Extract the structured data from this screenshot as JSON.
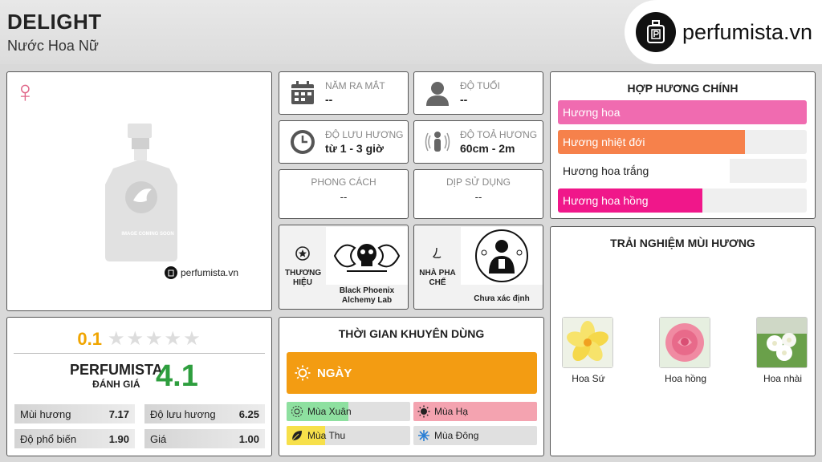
{
  "header": {
    "title": "DELIGHT",
    "subtitle": "Nước Hoa Nữ",
    "logo_text": "perfumista.vn"
  },
  "product": {
    "gender_symbol": "♀",
    "placeholder_text": "IMAGE COMING SOON",
    "watermark": "perfumista.vn"
  },
  "rating": {
    "user_score": "0.1",
    "stars_total": 5,
    "stars_filled": 0,
    "perfumista_label": "PERFUMISTA",
    "perfumista_sub": "ĐÁNH GIÁ",
    "perfumista_score": "4.1",
    "metrics": [
      {
        "label": "Mùi hương",
        "value": "7.17"
      },
      {
        "label": "Độ lưu hương",
        "value": "6.25"
      },
      {
        "label": "Độ phổ biến",
        "value": "1.90"
      },
      {
        "label": "Giá",
        "value": "1.00"
      }
    ]
  },
  "info": {
    "release": {
      "label": "NĂM RA MẮT",
      "value": "--"
    },
    "age": {
      "label": "ĐỘ TUỔI",
      "value": "--"
    },
    "longevity": {
      "label": "ĐỘ LƯU HƯƠNG",
      "value": "từ 1 - 3 giờ"
    },
    "sillage": {
      "label": "ĐỘ TOẢ HƯƠNG",
      "value": "60cm - 2m"
    },
    "style": {
      "label": "PHONG CÁCH",
      "value": "--"
    },
    "occasion": {
      "label": "DỊP SỬ DỤNG",
      "value": "--"
    },
    "brand": {
      "label": "THƯƠNG HIỆU",
      "value": "Black Phoenix Alchemy Lab"
    },
    "perfumer": {
      "label": "NHÀ PHA CHẾ",
      "value": "Chưa xác định"
    }
  },
  "time": {
    "heading": "THỜI GIAN KHUYÊN DÙNG",
    "day_label": "NGÀY",
    "seasons": [
      {
        "label": "Mùa Xuân",
        "level": 0.5,
        "color": "#8ee0a0",
        "icon": "spring-icon"
      },
      {
        "label": "Mùa Hạ",
        "level": 1.0,
        "color": "#f4a3b0",
        "icon": "summer-icon"
      },
      {
        "label": "Mùa Thu",
        "level": 0.31,
        "color": "#f7e04a",
        "icon": "leaf-icon"
      },
      {
        "label": "Mùa Đông",
        "level": 0.0,
        "color": "#b6d4ef",
        "icon": "snowflake-icon"
      }
    ]
  },
  "accords": {
    "heading": "HỢP HƯƠNG CHÍNH",
    "items": [
      {
        "label": "Hương hoa",
        "level": 1.0,
        "color": "#f06bb0"
      },
      {
        "label": "Hương nhiệt đới",
        "level": 0.75,
        "color": "#f6814b"
      },
      {
        "label": "Hương hoa trắng",
        "level": 0.69,
        "color": "#ffffff"
      },
      {
        "label": "Hương hoa hồng",
        "level": 0.58,
        "color": "#f0178a"
      }
    ]
  },
  "notes": {
    "heading": "TRẢI NGHIỆM MÙI HƯƠNG",
    "items": [
      {
        "name": "Hoa Sứ"
      },
      {
        "name": "Hoa hồng"
      },
      {
        "name": "Hoa nhài"
      }
    ]
  }
}
